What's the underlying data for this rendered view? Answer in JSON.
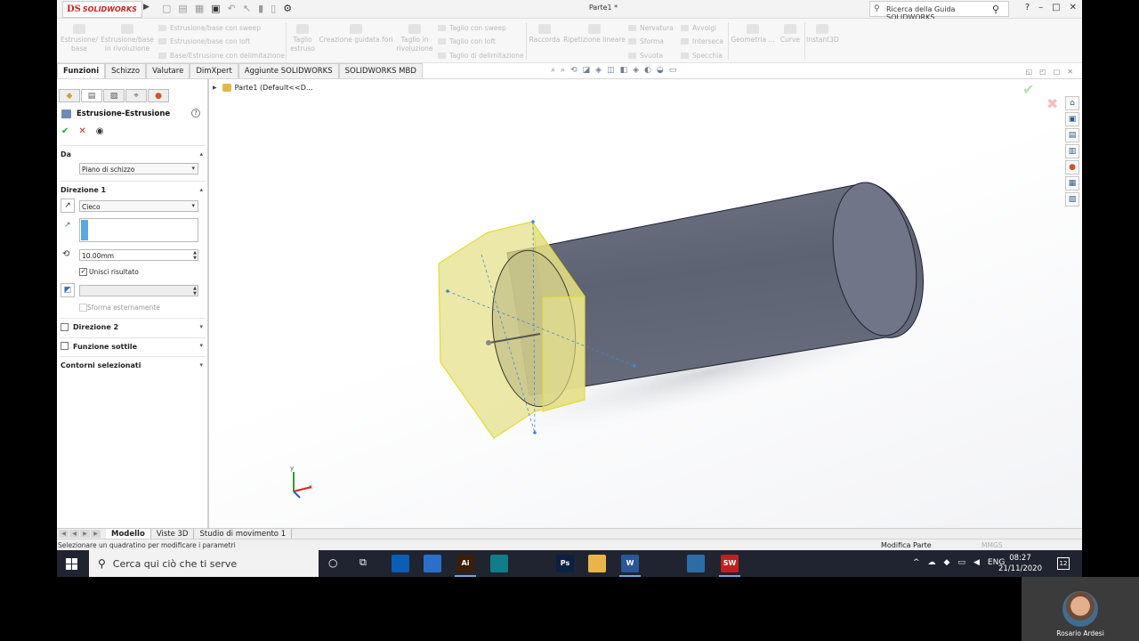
{
  "app": {
    "logo_ds": "DS",
    "logo_name": "SOLIDWORKS",
    "doc_title": "Parte1 *",
    "help_search_placeholder": "Ricerca della Guida SOLIDWORKS",
    "win_controls": [
      "?",
      "–",
      "□",
      "✕"
    ]
  },
  "command_manager": {
    "estrusione_base": "Estrusione/\nbase",
    "estrusione_rivoluzione": "Estrusione/base\nin rivoluzione",
    "sweep": "Estrusione/base con sweep",
    "loft": "Estrusione/base con loft",
    "delimitazione": "Base/Estrusione con delimitazione",
    "taglio_estruso": "Taglio\nestruso",
    "guidata_fori": "Creazione guidata fori",
    "taglio_rivoluzione": "Taglio in\nrivoluzione",
    "taglio_sweep": "Taglio con sweep",
    "taglio_loft": "Taglio con loft",
    "taglio_delimitazione": "Taglio di delimitazione",
    "raccorda": "Raccorda",
    "ripetizione_lineare": "Ripetizione lineare",
    "nervatura": "Nervatura",
    "sforma": "Sforma",
    "svuota": "Svuota",
    "avvolgi": "Avvolgi",
    "interseca": "Interseca",
    "specchia": "Specchia",
    "geometria": "Geometria ...",
    "curve": "Curve",
    "instant3d": "Instant3D"
  },
  "tabs": [
    "Funzioni",
    "Schizzo",
    "Valutare",
    "DimXpert",
    "Aggiunte SOLIDWORKS",
    "SOLIDWORKS MBD"
  ],
  "property_manager": {
    "title": "Estrusione-Estrusione",
    "help": "?",
    "da_label": "Da",
    "da_value": "Piano di schizzo",
    "direzione1_label": "Direzione 1",
    "end_condition": "Cieco",
    "depth": "10.00mm",
    "unisci_label": "Unisci risultato",
    "sforma_label": "Sforma esternamente",
    "direzione2_label": "Direzione 2",
    "funzione_sottile_label": "Funzione sottile",
    "contorni_label": "Contorni selezionati"
  },
  "tree": {
    "root": "Parte1  (Default<<D..."
  },
  "triad": {
    "x": "x",
    "y": "y"
  },
  "bottom_tabs": [
    "Modello",
    "Viste 3D",
    "Studio di movimento 1"
  ],
  "status": {
    "text": "Selezionare un quadratino per modificare i parametri",
    "mode": "Modifica Parte",
    "units": "MMGS"
  },
  "taskbar": {
    "search_placeholder": "Cerca qui ciò che ti serve",
    "lang": "ENG",
    "time": "08:27",
    "date": "21/11/2020",
    "notifications": "12",
    "apps": [
      {
        "label": "",
        "color": "#1e3b6c"
      },
      {
        "label": "",
        "color": "#1f2430"
      },
      {
        "label": "",
        "color": "#0a5eb5"
      },
      {
        "label": "",
        "color": "#2b6fc8"
      },
      {
        "label": "Ai",
        "color": "#3b1e0a"
      },
      {
        "label": "",
        "color": "#0f7d8a"
      },
      {
        "label": "",
        "color": "#1f2430"
      },
      {
        "label": "Ps",
        "color": "#0a2142"
      },
      {
        "label": "",
        "color": "#e9b54a"
      },
      {
        "label": "W",
        "color": "#2b579a"
      },
      {
        "label": "",
        "color": "#1f2430"
      },
      {
        "label": "",
        "color": "#2e6ca8"
      },
      {
        "label": "SW",
        "color": "#c31f1f"
      }
    ]
  },
  "webcam": {
    "name": "Rosario Ardesi"
  },
  "colors": {
    "extrude_preview": "#e6e08a",
    "cylinder": "#6c7282",
    "selection_blue": "#5ba6e8",
    "accent_red": "#cc1f1f"
  }
}
